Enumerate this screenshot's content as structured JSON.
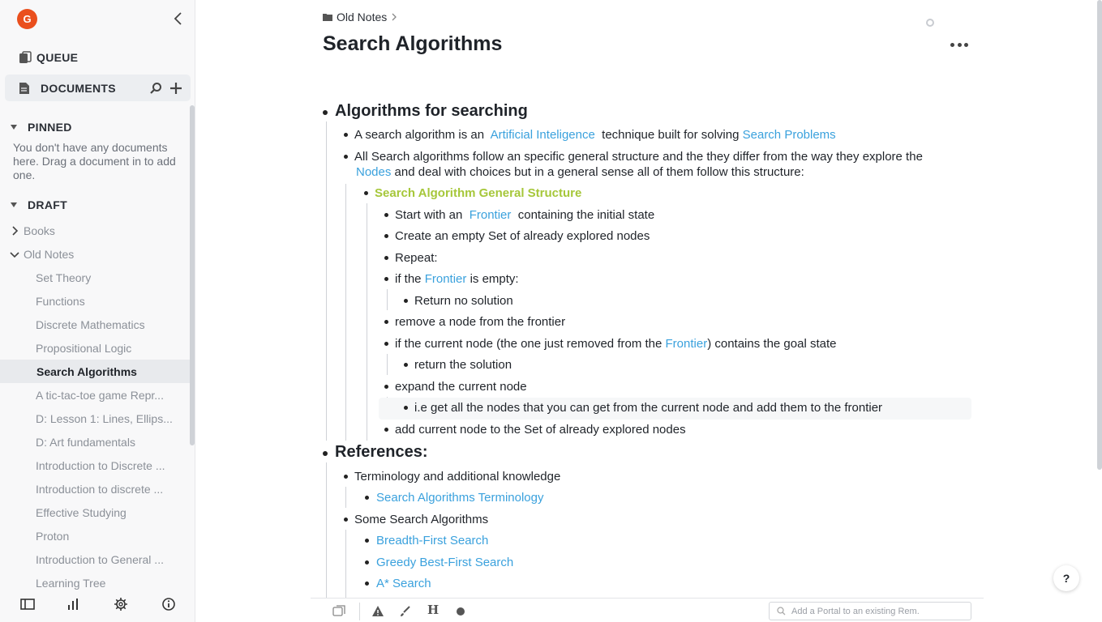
{
  "user": {
    "avatar_letter": "G"
  },
  "sidebar": {
    "queue_label": "QUEUE",
    "documents_label": "DOCUMENTS",
    "pinned": {
      "label": "PINNED",
      "empty_message": "You don't have any documents here. Drag a document in to add one."
    },
    "draft": {
      "label": "DRAFT"
    },
    "folders": [
      {
        "label": "Books",
        "expanded": false
      },
      {
        "label": "Old Notes",
        "expanded": true
      }
    ],
    "documents": [
      "Set Theory",
      "Functions",
      "Discrete Mathematics",
      "Propositional Logic",
      "Search Algorithms",
      "A tic-tac-toe game Repr...",
      "D: Lesson 1: Lines, Ellips...",
      "D: Art fundamentals",
      "Introduction to Discrete ...",
      "Introduction to discrete ...",
      "Effective Studying",
      "Proton",
      "Introduction to General ...",
      "Learning Tree"
    ],
    "active_document": "Search Algorithms"
  },
  "breadcrumb": {
    "folder": "Old Notes"
  },
  "page": {
    "title": "Search Algorithms"
  },
  "content": {
    "h1": "Algorithms for searching",
    "b1": {
      "pre": "A search algorithm is an",
      "link1": "Artificial Inteligence",
      "mid": "technique built for solving",
      "link2": "Search Problems"
    },
    "b2": {
      "line1": "All Search algorithms follow an specific general structure and the they differ from the way they explore the",
      "link": "Nodes",
      "line2": "and deal with choices but in a general sense all of them follow this structure:"
    },
    "structure_title": "Search Algorithm General Structure",
    "s1": {
      "pre": "Start with an",
      "link": "Frontier",
      "post": "containing the initial state"
    },
    "s2": "Create an empty Set  of already explored nodes",
    "s3": "Repeat:",
    "s4": {
      "pre": "if the",
      "link": "Frontier",
      "post": "is empty:"
    },
    "s4a": "Return no solution",
    "s5": "remove a node from the frontier",
    "s6": {
      "pre": "if the current node (the one just removed from the",
      "link": "Frontier",
      "post": ")  contains the goal state"
    },
    "s6a": "return the solution",
    "s7": "expand the current node",
    "s7a": "i.e get all the nodes that you can get from the current node and add them to the frontier",
    "s8": "add current node to the Set  of already explored nodes",
    "h2": "References:",
    "r1": "Terminology and additional knowledge",
    "r1a": "Search Algorithms Terminology",
    "r2": "Some Search Algorithms",
    "r2a": "Breadth-First Search",
    "r2b": "Greedy Best-First Search",
    "r2c": "A* Search"
  },
  "toolbar": {
    "portal_placeholder": "Add a Portal to an existing Rem.",
    "heading_label": "H"
  },
  "help": {
    "label": "?"
  }
}
